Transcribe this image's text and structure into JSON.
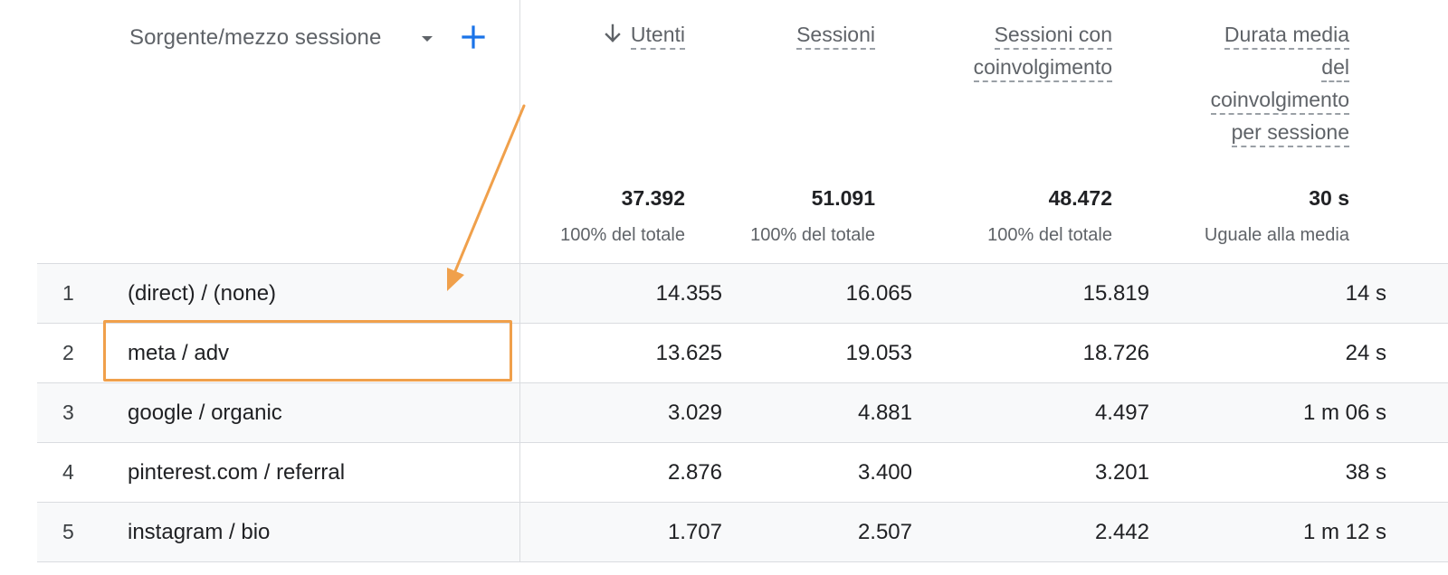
{
  "dimension": {
    "label": "Sorgente/mezzo sessione",
    "dropdown_icon": "caret-down-icon",
    "add_icon": "plus-icon",
    "accent_color": "#1a73e8"
  },
  "metrics": [
    {
      "key": "utenti",
      "lines": [
        "Utenti"
      ],
      "sorted": true,
      "sort_icon": "arrow-down-icon",
      "total": "37.392",
      "total_sub": "100% del totale"
    },
    {
      "key": "sessioni",
      "lines": [
        "Sessioni"
      ],
      "sorted": false,
      "total": "51.091",
      "total_sub": "100% del totale"
    },
    {
      "key": "coinv",
      "lines": [
        "Sessioni con",
        "coinvolgimento"
      ],
      "sorted": false,
      "total": "48.472",
      "total_sub": "100% del totale"
    },
    {
      "key": "durata",
      "lines": [
        "Durata media",
        "del",
        "coinvolgimento",
        "per sessione"
      ],
      "sorted": false,
      "total": "30 s",
      "total_sub": "Uguale alla media"
    }
  ],
  "rows": [
    {
      "index": "1",
      "dimension": "(direct) / (none)",
      "values": [
        "14.355",
        "16.065",
        "15.819",
        "14 s"
      ]
    },
    {
      "index": "2",
      "dimension": "meta / adv",
      "values": [
        "13.625",
        "19.053",
        "18.726",
        "24 s"
      ]
    },
    {
      "index": "3",
      "dimension": "google / organic",
      "values": [
        "3.029",
        "4.881",
        "4.497",
        "1 m 06 s"
      ]
    },
    {
      "index": "4",
      "dimension": "pinterest.com / referral",
      "values": [
        "2.876",
        "3.400",
        "3.201",
        "38 s"
      ]
    },
    {
      "index": "5",
      "dimension": "instagram / bio",
      "values": [
        "1.707",
        "2.507",
        "2.442",
        "1 m 12 s"
      ]
    }
  ],
  "annotation": {
    "color": "#f0a04b",
    "highlighted_row": "2"
  }
}
